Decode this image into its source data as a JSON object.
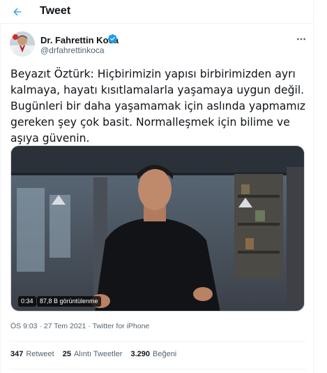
{
  "header": {
    "title": "Tweet",
    "back_icon": "arrow-left-icon"
  },
  "author": {
    "name": "Dr. Fahrettin Koca",
    "handle": "@drfahrettinkoca",
    "verified_icon": "verified-badge-icon",
    "more_icon": "more-horizontal-icon"
  },
  "tweet": {
    "text": "Beyazıt Öztürk: Hiçbirimizin yapısı birbirimizden ayrı kalmaya, hayatı kısıtlamalarla yaşamaya uygun değil. Bugünleri bir daha yaşamamak için aslında yapmamız gereken şey çok basit. Normalleşmek için bilime ve aşıya güvenin."
  },
  "media": {
    "duration": "0:34",
    "views": "87,8 B görüntülenme"
  },
  "meta": {
    "time": "ÖS 9:03",
    "separator": "·",
    "date": "27 Tem 2021",
    "source": "Twitter for iPhone"
  },
  "stats": {
    "retweets_count": "347",
    "retweets_label": "Retweet",
    "quotes_count": "25",
    "quotes_label": "Alıntı Tweetler",
    "likes_count": "3.290",
    "likes_label": "Beğeni"
  },
  "colors": {
    "accent": "#1d9bf0",
    "text": "#0f1419",
    "muted": "#536471",
    "border": "#eff3f4"
  }
}
